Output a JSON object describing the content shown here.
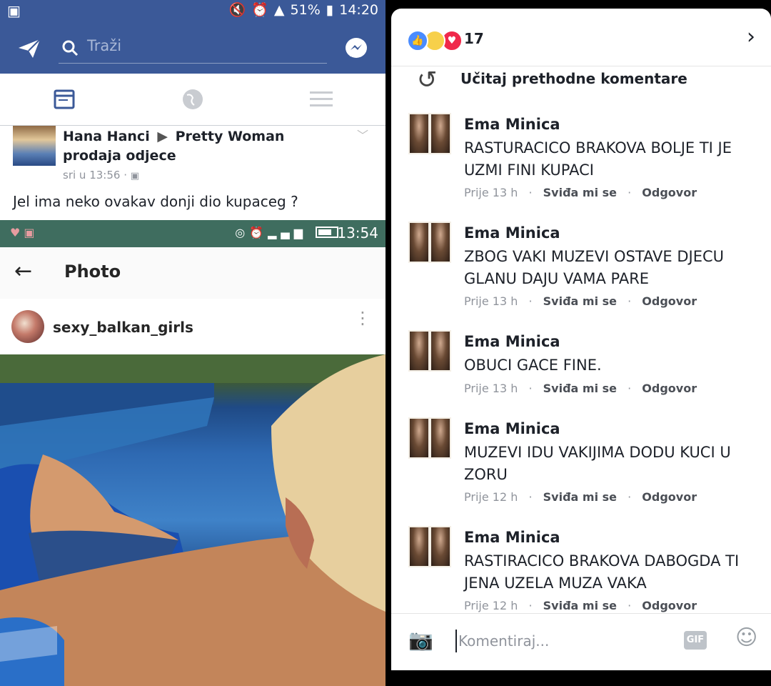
{
  "left": {
    "status_top": {
      "battery": "51%",
      "time": "14:20"
    },
    "search": {
      "placeholder": "Traži"
    },
    "post": {
      "author": "Hana Hanci",
      "arrow": "▶",
      "group": "Pretty Woman prodaja odjece",
      "time": "sri u 13:56 ·",
      "body": "Jel ima neko ovakav donji dio kupaceg ?"
    },
    "status_inner": {
      "time": "13:54"
    },
    "photo_view": {
      "title": "Photo",
      "username": "sexy_balkan_girls"
    }
  },
  "right": {
    "reactions": {
      "count": "17"
    },
    "load_previous": "Učitaj prethodne komentare",
    "actions": {
      "like": "Sviđa mi se",
      "reply": "Odgovor",
      "dot": "·"
    },
    "comments": [
      {
        "author": "Ema Minica",
        "text": "RASTURACICO BRAKOVA BOLJE TI JE UZMI FINI KUPACI",
        "time": "Prije 13 h"
      },
      {
        "author": "Ema Minica",
        "text": "ZBOG VAKI MUZEVI OSTAVE DJECU GLANU DAJU VAMA PARE",
        "time": "Prije 13 h"
      },
      {
        "author": "Ema Minica",
        "text": "OBUCI GACE FINE.",
        "time": "Prije 13 h"
      },
      {
        "author": "Ema Minica",
        "text": "MUZEVI IDU VAKIJIMA DODU KUCI U ZORU",
        "time": "Prije 12 h"
      },
      {
        "author": "Ema Minica",
        "text": "RASTIRACICO BRAKOVA DABOGDA TI JENA UZELA MUZA VAKA",
        "time": "Prije 12 h"
      }
    ],
    "composer": {
      "placeholder": "Komentiraj...",
      "gif_label": "GIF"
    }
  },
  "colors": {
    "facebook_blue": "#3b5998",
    "status_green": "#3f6d5f"
  }
}
